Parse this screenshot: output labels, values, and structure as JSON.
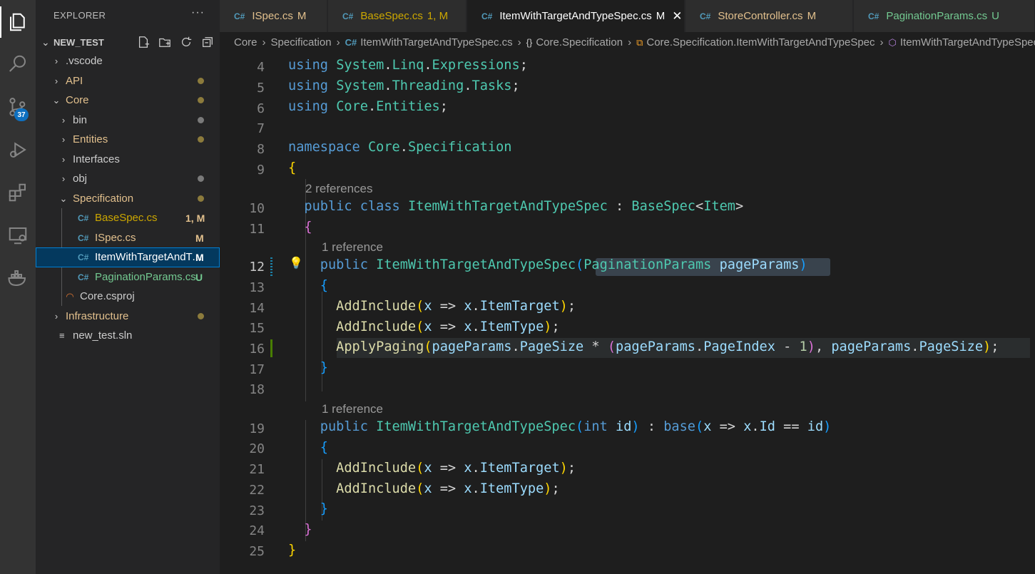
{
  "sidebar": {
    "title": "EXPLORER",
    "more": "···",
    "project": "NEW_TEST",
    "tree": [
      {
        "label": ".vscode",
        "kind": "folder",
        "open": false,
        "color": "#cccccc",
        "dot": null,
        "status": ""
      },
      {
        "label": "API",
        "kind": "folder",
        "open": false,
        "color": "#e2c08d",
        "dot": "#8c7b3c",
        "status": ""
      },
      {
        "label": "Core",
        "kind": "folder",
        "open": true,
        "color": "#e2c08d",
        "dot": "#8c7b3c",
        "status": ""
      },
      {
        "label": "bin",
        "kind": "folder",
        "open": false,
        "color": "#cccccc",
        "dot": "#7a7a7a",
        "status": ""
      },
      {
        "label": "Entities",
        "kind": "folder",
        "open": false,
        "color": "#e2c08d",
        "dot": "#8c7b3c",
        "status": ""
      },
      {
        "label": "Interfaces",
        "kind": "folder",
        "open": false,
        "color": "#cccccc",
        "dot": null,
        "status": ""
      },
      {
        "label": "obj",
        "kind": "folder",
        "open": false,
        "color": "#cccccc",
        "dot": "#7a7a7a",
        "status": ""
      },
      {
        "label": "Specification",
        "kind": "folder",
        "open": true,
        "color": "#e2c08d",
        "dot": "#8c7b3c",
        "status": ""
      },
      {
        "label": "BaseSpec.cs",
        "kind": "cs",
        "color": "#cca700",
        "status": "1, M",
        "statusColor": "#e2c08d"
      },
      {
        "label": "ISpec.cs",
        "kind": "cs",
        "color": "#e2c08d",
        "status": "M",
        "statusColor": "#e2c08d"
      },
      {
        "label": "ItemWithTargetAndTypeSpec.cs",
        "kind": "cs",
        "color": "#ffffff",
        "status": "M",
        "statusColor": "#ffffff",
        "selected": true
      },
      {
        "label": "PaginationParams.cs",
        "kind": "cs",
        "color": "#73c991",
        "status": "U",
        "statusColor": "#73c991"
      },
      {
        "label": "Core.csproj",
        "kind": "rss",
        "color": "#cccccc",
        "status": ""
      },
      {
        "label": "Infrastructure",
        "kind": "folder",
        "open": false,
        "color": "#e2c08d",
        "dot": "#8c7b3c",
        "status": ""
      },
      {
        "label": "new_test.sln",
        "kind": "lines",
        "color": "#cccccc",
        "status": ""
      }
    ]
  },
  "activity": {
    "scm_badge": "37"
  },
  "tabs": [
    {
      "label": "ISpec.cs",
      "status": "M",
      "color": "#e2c08d",
      "active": false
    },
    {
      "label": "BaseSpec.cs",
      "status": "1, M",
      "color": "#cca700",
      "active": false
    },
    {
      "label": "ItemWithTargetAndTypeSpec.cs",
      "status": "M",
      "color": "#ffffff",
      "active": true
    },
    {
      "label": "StoreController.cs",
      "status": "M",
      "color": "#e2c08d",
      "active": false
    },
    {
      "label": "PaginationParams.cs",
      "status": "U",
      "color": "#73c991",
      "active": false
    }
  ],
  "breadcrumbs": {
    "c1": "Core",
    "c2": "Specification",
    "c3": "ItemWithTargetAndTypeSpec.cs",
    "c4": "Core.Specification",
    "c5": "Core.Specification.ItemWithTargetAndTypeSpec",
    "c6": "ItemWithTargetAndTypeSpec"
  },
  "editor": {
    "lines": [
      {
        "n": "4"
      },
      {
        "n": "5"
      },
      {
        "n": "6"
      },
      {
        "n": "7"
      },
      {
        "n": "8"
      },
      {
        "n": "9"
      },
      {
        "n": "10"
      },
      {
        "n": "11"
      },
      {
        "n": "12"
      },
      {
        "n": "13"
      },
      {
        "n": "14"
      },
      {
        "n": "15"
      },
      {
        "n": "16"
      },
      {
        "n": "17"
      },
      {
        "n": "18"
      },
      {
        "n": "19"
      },
      {
        "n": "20"
      },
      {
        "n": "21"
      },
      {
        "n": "22"
      },
      {
        "n": "23"
      },
      {
        "n": "24"
      },
      {
        "n": "25"
      }
    ],
    "lens_class": "2 references",
    "lens_ctor1": "1 reference",
    "lens_ctor2": "1 reference",
    "tokens": {
      "using": "using",
      "ns_system": "System",
      "linq": "Linq",
      "expressions": "Expressions",
      "threading": "Threading",
      "tasks": "Tasks",
      "core": "Core",
      "entities": "Entities",
      "namespace": "namespace",
      "specification": "Specification",
      "public": "public",
      "class": "class",
      "class_name": "ItemWithTargetAndTypeSpec",
      "base_spec": "BaseSpec",
      "item": "Item",
      "pagination_params": "PaginationParams",
      "page_params": "pageParams",
      "add_include": "AddInclude",
      "x": "x",
      "item_target": "ItemTarget",
      "item_type": "ItemType",
      "apply_paging": "ApplyPaging",
      "page_size": "PageSize",
      "page_index": "PageIndex",
      "one": "1",
      "int": "int",
      "id": "id",
      "base": "base",
      "Id": "Id"
    }
  }
}
